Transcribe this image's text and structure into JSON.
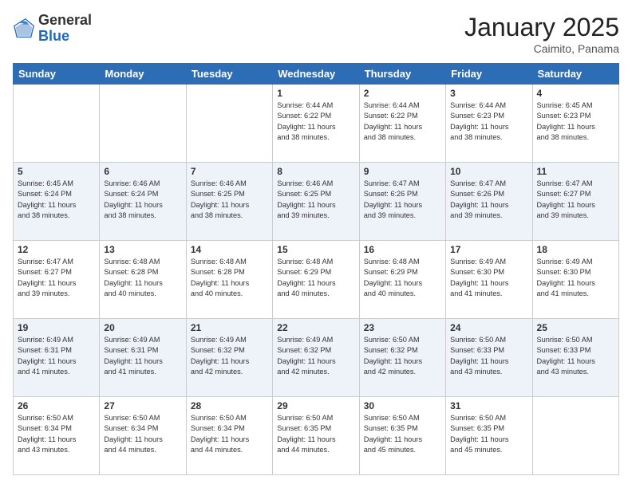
{
  "header": {
    "logo_general": "General",
    "logo_blue": "Blue",
    "month_title": "January 2025",
    "subtitle": "Caimito, Panama"
  },
  "days_of_week": [
    "Sunday",
    "Monday",
    "Tuesday",
    "Wednesday",
    "Thursday",
    "Friday",
    "Saturday"
  ],
  "weeks": [
    [
      {
        "num": "",
        "info": ""
      },
      {
        "num": "",
        "info": ""
      },
      {
        "num": "",
        "info": ""
      },
      {
        "num": "1",
        "info": "Sunrise: 6:44 AM\nSunset: 6:22 PM\nDaylight: 11 hours\nand 38 minutes."
      },
      {
        "num": "2",
        "info": "Sunrise: 6:44 AM\nSunset: 6:22 PM\nDaylight: 11 hours\nand 38 minutes."
      },
      {
        "num": "3",
        "info": "Sunrise: 6:44 AM\nSunset: 6:23 PM\nDaylight: 11 hours\nand 38 minutes."
      },
      {
        "num": "4",
        "info": "Sunrise: 6:45 AM\nSunset: 6:23 PM\nDaylight: 11 hours\nand 38 minutes."
      }
    ],
    [
      {
        "num": "5",
        "info": "Sunrise: 6:45 AM\nSunset: 6:24 PM\nDaylight: 11 hours\nand 38 minutes."
      },
      {
        "num": "6",
        "info": "Sunrise: 6:46 AM\nSunset: 6:24 PM\nDaylight: 11 hours\nand 38 minutes."
      },
      {
        "num": "7",
        "info": "Sunrise: 6:46 AM\nSunset: 6:25 PM\nDaylight: 11 hours\nand 38 minutes."
      },
      {
        "num": "8",
        "info": "Sunrise: 6:46 AM\nSunset: 6:25 PM\nDaylight: 11 hours\nand 39 minutes."
      },
      {
        "num": "9",
        "info": "Sunrise: 6:47 AM\nSunset: 6:26 PM\nDaylight: 11 hours\nand 39 minutes."
      },
      {
        "num": "10",
        "info": "Sunrise: 6:47 AM\nSunset: 6:26 PM\nDaylight: 11 hours\nand 39 minutes."
      },
      {
        "num": "11",
        "info": "Sunrise: 6:47 AM\nSunset: 6:27 PM\nDaylight: 11 hours\nand 39 minutes."
      }
    ],
    [
      {
        "num": "12",
        "info": "Sunrise: 6:47 AM\nSunset: 6:27 PM\nDaylight: 11 hours\nand 39 minutes."
      },
      {
        "num": "13",
        "info": "Sunrise: 6:48 AM\nSunset: 6:28 PM\nDaylight: 11 hours\nand 40 minutes."
      },
      {
        "num": "14",
        "info": "Sunrise: 6:48 AM\nSunset: 6:28 PM\nDaylight: 11 hours\nand 40 minutes."
      },
      {
        "num": "15",
        "info": "Sunrise: 6:48 AM\nSunset: 6:29 PM\nDaylight: 11 hours\nand 40 minutes."
      },
      {
        "num": "16",
        "info": "Sunrise: 6:48 AM\nSunset: 6:29 PM\nDaylight: 11 hours\nand 40 minutes."
      },
      {
        "num": "17",
        "info": "Sunrise: 6:49 AM\nSunset: 6:30 PM\nDaylight: 11 hours\nand 41 minutes."
      },
      {
        "num": "18",
        "info": "Sunrise: 6:49 AM\nSunset: 6:30 PM\nDaylight: 11 hours\nand 41 minutes."
      }
    ],
    [
      {
        "num": "19",
        "info": "Sunrise: 6:49 AM\nSunset: 6:31 PM\nDaylight: 11 hours\nand 41 minutes."
      },
      {
        "num": "20",
        "info": "Sunrise: 6:49 AM\nSunset: 6:31 PM\nDaylight: 11 hours\nand 41 minutes."
      },
      {
        "num": "21",
        "info": "Sunrise: 6:49 AM\nSunset: 6:32 PM\nDaylight: 11 hours\nand 42 minutes."
      },
      {
        "num": "22",
        "info": "Sunrise: 6:49 AM\nSunset: 6:32 PM\nDaylight: 11 hours\nand 42 minutes."
      },
      {
        "num": "23",
        "info": "Sunrise: 6:50 AM\nSunset: 6:32 PM\nDaylight: 11 hours\nand 42 minutes."
      },
      {
        "num": "24",
        "info": "Sunrise: 6:50 AM\nSunset: 6:33 PM\nDaylight: 11 hours\nand 43 minutes."
      },
      {
        "num": "25",
        "info": "Sunrise: 6:50 AM\nSunset: 6:33 PM\nDaylight: 11 hours\nand 43 minutes."
      }
    ],
    [
      {
        "num": "26",
        "info": "Sunrise: 6:50 AM\nSunset: 6:34 PM\nDaylight: 11 hours\nand 43 minutes."
      },
      {
        "num": "27",
        "info": "Sunrise: 6:50 AM\nSunset: 6:34 PM\nDaylight: 11 hours\nand 44 minutes."
      },
      {
        "num": "28",
        "info": "Sunrise: 6:50 AM\nSunset: 6:34 PM\nDaylight: 11 hours\nand 44 minutes."
      },
      {
        "num": "29",
        "info": "Sunrise: 6:50 AM\nSunset: 6:35 PM\nDaylight: 11 hours\nand 44 minutes."
      },
      {
        "num": "30",
        "info": "Sunrise: 6:50 AM\nSunset: 6:35 PM\nDaylight: 11 hours\nand 45 minutes."
      },
      {
        "num": "31",
        "info": "Sunrise: 6:50 AM\nSunset: 6:35 PM\nDaylight: 11 hours\nand 45 minutes."
      },
      {
        "num": "",
        "info": ""
      }
    ]
  ]
}
